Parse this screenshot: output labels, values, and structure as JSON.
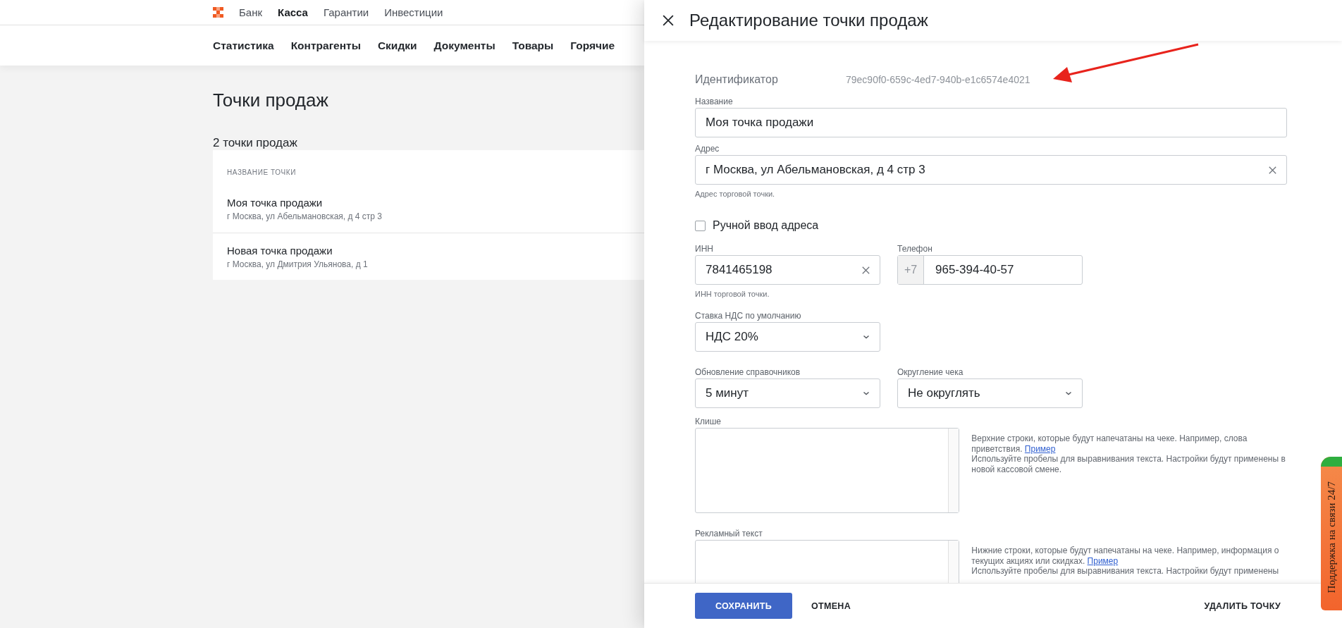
{
  "top_nav": {
    "items": [
      {
        "label": "Банк",
        "selected": false
      },
      {
        "label": "Касса",
        "selected": true
      },
      {
        "label": "Гарантии",
        "selected": false
      },
      {
        "label": "Инвестиции",
        "selected": false
      }
    ]
  },
  "section_nav": {
    "items": [
      "Статистика",
      "Контрагенты",
      "Скидки",
      "Документы",
      "Товары",
      "Горячие"
    ]
  },
  "page": {
    "title": "Точки продаж",
    "count": "2 точки продаж",
    "table": {
      "columns": [
        "НАЗВАНИЕ ТОЧКИ"
      ],
      "rows": [
        {
          "name": "Моя точка продажи",
          "address": "г Москва, ул Абельмановская, д 4 стр 3"
        },
        {
          "name": "Новая точка продажи",
          "address": "г Москва, ул Дмитрия Ульянова, д 1"
        }
      ]
    }
  },
  "drawer": {
    "title": "Редактирование точки продаж",
    "identifier": {
      "label": "Идентификатор",
      "value": "79ec90f0-659c-4ed7-940b-e1c6574e4021"
    },
    "rows": [
      [
        {
          "kind": "text",
          "label": "Название",
          "value": "Моя точка продажи",
          "clearable": false
        }
      ],
      [
        {
          "kind": "text",
          "label": "Адрес",
          "value": "г Москва, ул Абельмановская, д 4 стр 3",
          "clearable": true,
          "hint": "Адрес торговой точки."
        }
      ],
      [
        {
          "kind": "checkbox",
          "label": "Ручной ввод адреса",
          "checked": false
        }
      ],
      [
        {
          "kind": "text",
          "label": "ИНН",
          "value": "7841465198",
          "clearable": true,
          "hint": "ИНН торговой точки."
        },
        {
          "kind": "phone",
          "label": "Телефон",
          "prefix": "+7",
          "value": "965-394-40-57"
        }
      ],
      [
        {
          "kind": "select",
          "label": "Ставка НДС по умолчанию",
          "value": "НДС 20%"
        }
      ],
      [
        {
          "kind": "select",
          "label": "Обновление справочников",
          "value": "5 минут"
        },
        {
          "kind": "select",
          "label": "Округление чека",
          "value": "Не округлять"
        }
      ],
      [
        {
          "kind": "textarea",
          "label": "Клише",
          "help": {
            "text": "Верхние строки, которые будут напечатаны на чеке. Например, слова приветствия.",
            "link": "Пример",
            "note": "Используйте пробелы для выравнивания текста. Настройки будут применены в новой кассовой смене."
          }
        }
      ],
      [
        {
          "kind": "textarea",
          "label": "Рекламный текст",
          "help": {
            "text": "Нижние строки, которые будут напечатаны на чеке. Например, информация о текущих акциях или скидках.",
            "link": "Пример",
            "note": "Используйте пробелы для выравнивания текста. Настройки будут применены"
          }
        }
      ]
    ],
    "buttons": [
      {
        "label": "СОХРАНИТЬ",
        "kind": "primary"
      },
      {
        "label": "ОТМЕНА",
        "kind": "flat"
      },
      {
        "label": "УДАЛИТЬ ТОЧКУ",
        "kind": "danger"
      }
    ]
  },
  "support_tab": {
    "label": "Поддержка на связи 24/7"
  }
}
